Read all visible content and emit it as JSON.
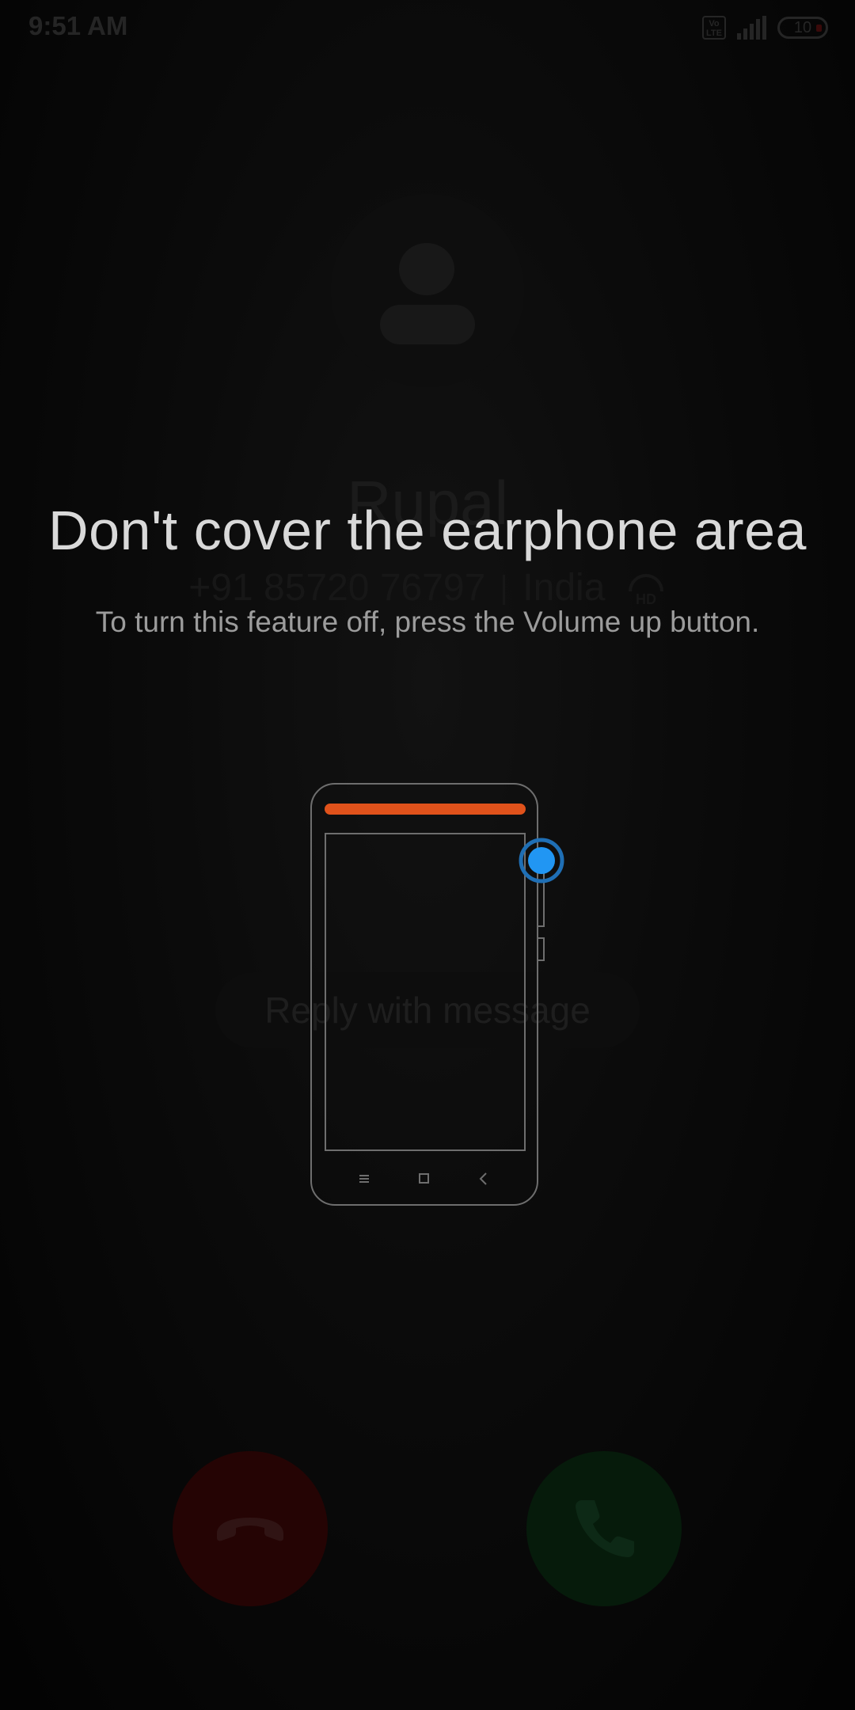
{
  "status_bar": {
    "time": "9:51 AM",
    "volte_label": "Vo LTE",
    "battery_level": "10",
    "icons": [
      "volte-icon",
      "signal-icon",
      "battery-icon"
    ]
  },
  "call": {
    "caller_name": "Rupal",
    "phone_number": "+91 85720 76797",
    "location": "India",
    "hd_icon": "hd-voice-icon",
    "reply_label": "Reply with message",
    "decline_icon": "phone-hangup-icon",
    "answer_icon": "phone-answer-icon",
    "colors": {
      "decline": "#3a0707",
      "answer": "#0a2a11"
    }
  },
  "overlay": {
    "title": "Don't cover the earphone area",
    "subtitle": "To turn this feature off, press the Volume up button.",
    "illustration_icon": "phone-illustration-icon",
    "colors": {
      "earpiece": "#e0521b",
      "volume_dot": "#2196f3"
    }
  }
}
